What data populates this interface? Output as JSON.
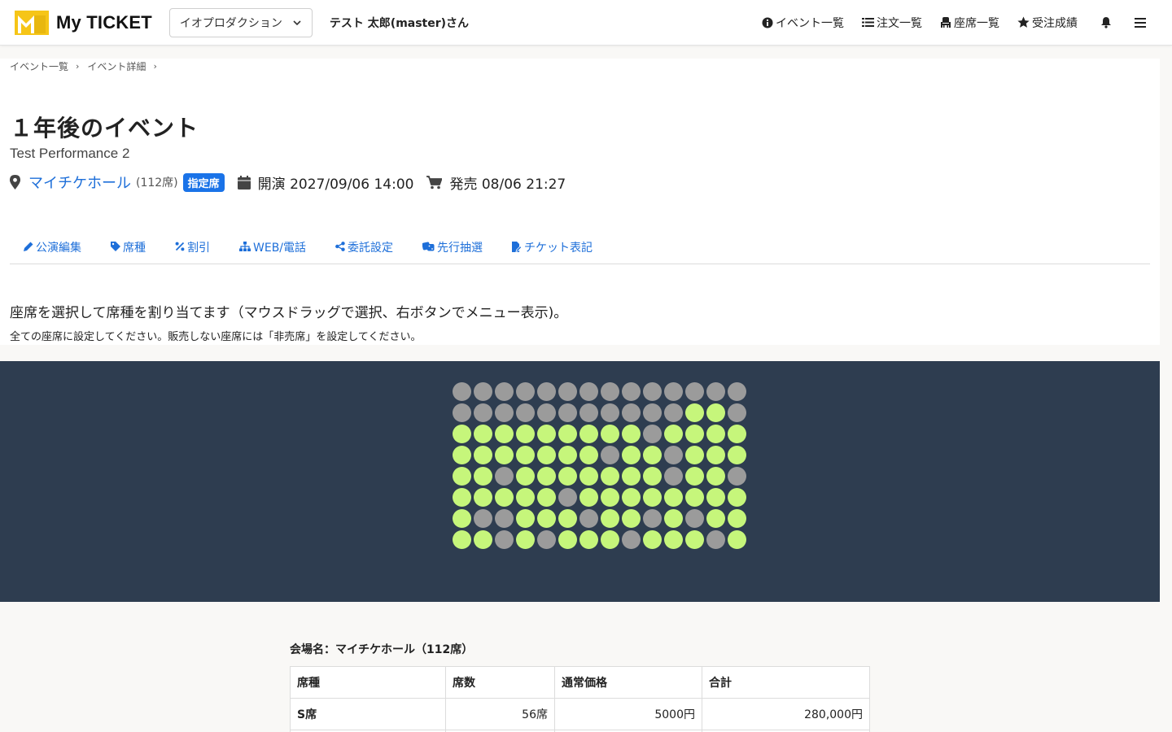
{
  "header": {
    "app_name": "My TICKET",
    "org_select": "イオプロダクション",
    "user_name": "テスト 太郎(master)さん",
    "nav": [
      {
        "label": "イベント一覧",
        "icon": "info-circle-icon"
      },
      {
        "label": "注文一覧",
        "icon": "list-icon"
      },
      {
        "label": "座席一覧",
        "icon": "seat-icon"
      },
      {
        "label": "受注成績",
        "icon": "star-icon"
      }
    ]
  },
  "breadcrumb": [
    "イベント一覧",
    "イベント詳細"
  ],
  "event": {
    "title": "１年後のイベント",
    "subtitle": "Test Performance 2",
    "venue": "マイチケホール",
    "capacity": "(112席)",
    "badge": "指定席",
    "performance": "開演 2027/09/06 14:00",
    "sale": "発売 08/06 21:27"
  },
  "tabs": [
    "公演編集",
    "席種",
    "割引",
    "WEB/電話",
    "委託設定",
    "先行抽選",
    "チケット表記"
  ],
  "instructions": {
    "main": "座席を選択して席種を割り当てます（マウスドラッグで選択、右ボタンでメニュー表示)。",
    "sub": "全ての座席に設定してください。販売しない座席には「非売席」を設定してください。"
  },
  "seat_map": {
    "colors": {
      "assigned": "#c6f67b",
      "unassigned": "#9b9b9b"
    },
    "legend": {
      "G": "assigned",
      "X": "unassigned"
    },
    "rows": [
      "XXXXXXXXXXXXXX",
      "XXXXXXXXXXXGGX",
      "GGGGGGGGGXGGGG",
      "GGGGGGGXGGXGGG",
      "GGXGGGGGGGXGGX",
      "GGGGGXGGGGGGGG",
      "GXXGGGXGGXGXGG",
      "GGXGXGGGXGGGXG"
    ]
  },
  "summary": {
    "venue_caption": "会場名：マイチケホール（112席）",
    "headers": [
      "席種",
      "席数",
      "通常価格",
      "合計"
    ],
    "rows": [
      {
        "name": "S席",
        "count": "56席",
        "price": "5000円",
        "total": "280,000円"
      }
    ]
  }
}
